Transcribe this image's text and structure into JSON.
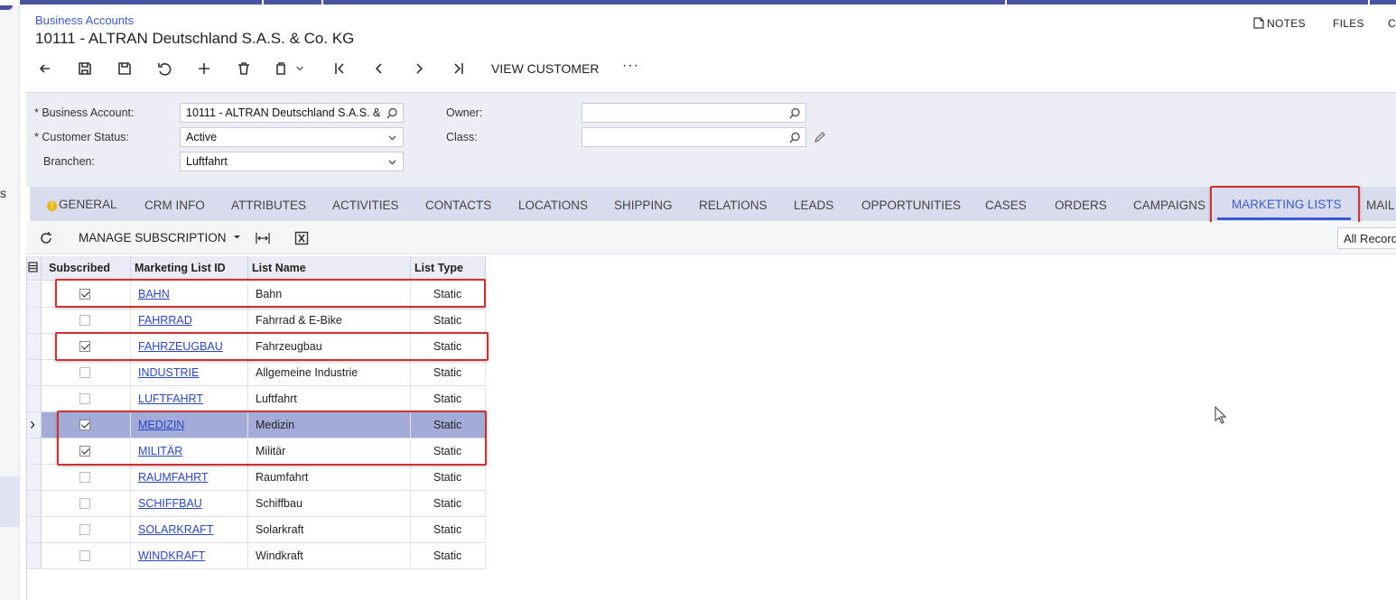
{
  "header": {
    "breadcrumb": "Business Accounts",
    "title": "10111 - ALTRAN Deutschland S.A.S. & Co. KG",
    "notes": "NOTES",
    "files": "FILES",
    "more": "C"
  },
  "leftnav": {
    "label": "s"
  },
  "toolbar": {
    "view_customer": "VIEW CUSTOMER",
    "more": "···"
  },
  "form": {
    "business_account_label": "Business Account:",
    "business_account_value": "10111 - ALTRAN Deutschland S.A.S. &",
    "customer_status_label": "Customer Status:",
    "customer_status_value": "Active",
    "branchen_label": "Branchen:",
    "branchen_value": "Luftfahrt",
    "owner_label": "Owner:",
    "owner_value": "",
    "class_label": "Class:",
    "class_value": ""
  },
  "tabs": [
    {
      "label": "GENERAL"
    },
    {
      "label": "CRM INFO"
    },
    {
      "label": "ATTRIBUTES"
    },
    {
      "label": "ACTIVITIES"
    },
    {
      "label": "CONTACTS"
    },
    {
      "label": "LOCATIONS"
    },
    {
      "label": "SHIPPING"
    },
    {
      "label": "RELATIONS"
    },
    {
      "label": "LEADS"
    },
    {
      "label": "OPPORTUNITIES"
    },
    {
      "label": "CASES"
    },
    {
      "label": "ORDERS"
    },
    {
      "label": "CAMPAIGNS"
    },
    {
      "label": "MARKETING LISTS"
    },
    {
      "label": "MAIL"
    }
  ],
  "grid_toolbar": {
    "manage_subscription": "MANAGE SUBSCRIPTION",
    "filter_value": "All Records"
  },
  "grid": {
    "columns": [
      "Subscribed",
      "Marketing List ID",
      "List Name",
      "List Type"
    ],
    "rows": [
      {
        "subscribed": true,
        "id": "BAHN",
        "name": "Bahn",
        "type": "Static"
      },
      {
        "subscribed": false,
        "id": "FAHRRAD",
        "name": "Fahrrad & E-Bike",
        "type": "Static"
      },
      {
        "subscribed": true,
        "id": "FAHRZEUGBAU",
        "name": "Fahrzeugbau",
        "type": "Static"
      },
      {
        "subscribed": false,
        "id": "INDUSTRIE",
        "name": "Allgemeine Industrie",
        "type": "Static"
      },
      {
        "subscribed": false,
        "id": "LUFTFAHRT",
        "name": "Luftfahrt",
        "type": "Static"
      },
      {
        "subscribed": true,
        "id": "MEDIZIN",
        "name": "Medizin",
        "type": "Static"
      },
      {
        "subscribed": true,
        "id": "MILITÄR",
        "name": "Militär",
        "type": "Static"
      },
      {
        "subscribed": false,
        "id": "RAUMFAHRT",
        "name": "Raumfahrt",
        "type": "Static"
      },
      {
        "subscribed": false,
        "id": "SCHIFFBAU",
        "name": "Schiffbau",
        "type": "Static"
      },
      {
        "subscribed": false,
        "id": "SOLARKRAFT",
        "name": "Solarkraft",
        "type": "Static"
      },
      {
        "subscribed": false,
        "id": "WINDKRAFT",
        "name": "Windkraft",
        "type": "Static"
      }
    ],
    "selected_row": "MEDIZIN"
  },
  "colors": {
    "accent": "#3a5bd1",
    "highlight_box": "#d32f2f",
    "selected_row": "#a3abd8"
  }
}
